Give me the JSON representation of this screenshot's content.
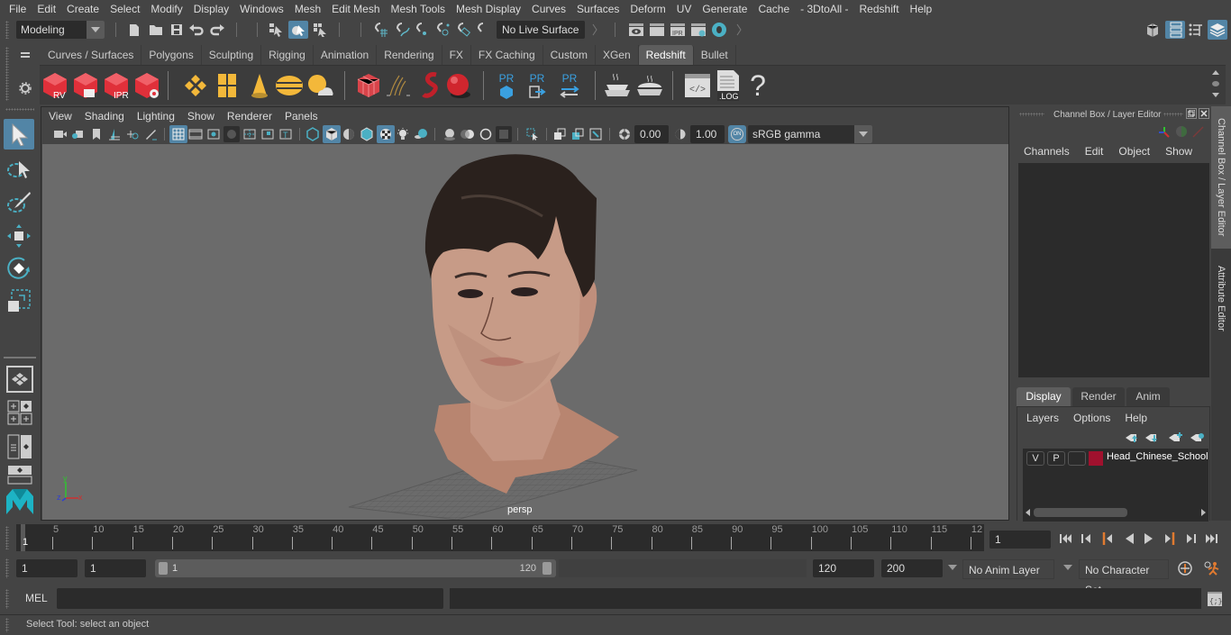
{
  "menubar": {
    "items": [
      "File",
      "Edit",
      "Create",
      "Select",
      "Modify",
      "Display",
      "Windows",
      "Mesh",
      "Edit Mesh",
      "Mesh Tools",
      "Mesh Display",
      "Curves",
      "Surfaces",
      "Deform",
      "UV",
      "Generate",
      "Cache",
      "- 3DtoAll -",
      "Redshift",
      "Help"
    ]
  },
  "status_line": {
    "mode_selector": "Modeling",
    "live_surface": "No Live Surface"
  },
  "shelf": {
    "tabs": [
      "Curves / Surfaces",
      "Polygons",
      "Sculpting",
      "Rigging",
      "Animation",
      "Rendering",
      "FX",
      "FX Caching",
      "Custom",
      "XGen",
      "Redshift",
      "Bullet"
    ],
    "active_tab": "Redshift",
    "icon_labels": {
      "rv": "RV",
      "ipr": "IPR",
      "pr1": "PR",
      "pr2": "PR",
      "pr3": "PR",
      "log": ".LOG",
      "help": "?"
    }
  },
  "viewport": {
    "menu": [
      "View",
      "Shading",
      "Lighting",
      "Show",
      "Renderer",
      "Panels"
    ],
    "exposure": "0.00",
    "gamma": "1.00",
    "color_mgmt_toggle": "ON",
    "color_space": "sRGB gamma",
    "camera_label": "persp",
    "axis_labels": {
      "x": "x",
      "y": "y",
      "z": "z"
    }
  },
  "channel_box": {
    "title": "Channel Box / Layer Editor",
    "menu": [
      "Channels",
      "Edit",
      "Object",
      "Show"
    ]
  },
  "layer_editor": {
    "tabs": [
      "Display",
      "Render",
      "Anim"
    ],
    "active_tab": "Display",
    "menu": [
      "Layers",
      "Options",
      "Help"
    ],
    "layers": [
      {
        "visible": "V",
        "playback": "P",
        "name": "Head_Chinese_School",
        "color": "#a0112e"
      }
    ]
  },
  "side_tabs": [
    "Channel Box / Layer Editor",
    "Attribute Editor"
  ],
  "timeline": {
    "ticks": [
      "5",
      "10",
      "15",
      "20",
      "25",
      "30",
      "35",
      "40",
      "45",
      "50",
      "55",
      "60",
      "65",
      "70",
      "75",
      "80",
      "85",
      "90",
      "95",
      "100",
      "105",
      "110",
      "115",
      "12"
    ],
    "current_frame_marker": "1",
    "current_frame": "1"
  },
  "range": {
    "start_time": "1",
    "playback_start": "1",
    "slider_start": "1",
    "slider_end": "120",
    "playback_end": "120",
    "end_time": "200",
    "anim_layer": "No Anim Layer",
    "character_set": "No Character Set"
  },
  "command_line": {
    "language": "MEL",
    "input": "",
    "result": ""
  },
  "help_line": {
    "text": "Select Tool: select an object"
  },
  "colors": {
    "accent": "#5285a6",
    "redshift_red": "#e0303a",
    "key_orange": "#e07a30"
  }
}
